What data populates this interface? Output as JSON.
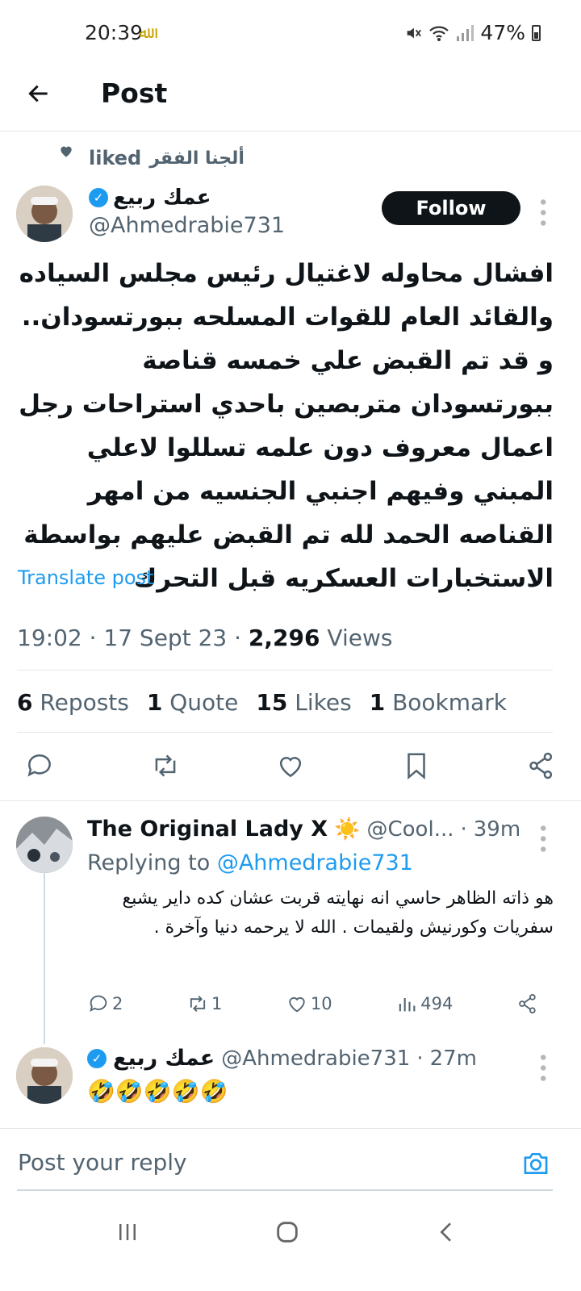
{
  "status_bar": {
    "time": "20:39",
    "battery": "47%"
  },
  "header": {
    "title": "Post"
  },
  "social_context": {
    "name": "ألجنا الفقر",
    "action": "liked"
  },
  "author": {
    "name": "عمك ربيع",
    "handle": "@Ahmedrabie731",
    "follow_label": "Follow"
  },
  "tweet": {
    "text": "افشال محاوله  لاغتيال رئيس مجلس السياده والقائد العام للقوات المسلحه ببورتسودان.. و قد تم القبض علي خمسه قناصة ببورتسودان متربصين باحدي استراحات رجل اعمال معروف دون علمه تسللوا لاعلي المبني  وفيهم اجنبي الجنسيه من امهر القناصه الحمد لله تم القبض عليهم بواسطة الاستخبارات العسكريه قبل التحرك",
    "translate_label": "Translate post",
    "time": "19:02",
    "date": "17 Sept 23",
    "views_count": "2,296",
    "views_label": "Views"
  },
  "stats": {
    "reposts_count": "6",
    "reposts_label": "Reposts",
    "quote_count": "1",
    "quote_label": "Quote",
    "likes_count": "15",
    "likes_label": "Likes",
    "bookmark_count": "1",
    "bookmark_label": "Bookmark"
  },
  "replies": [
    {
      "name": "The Original Lady X",
      "emoji": "☀️",
      "handle": "@Cool...",
      "time": "39m",
      "replying_prefix": "Replying to",
      "replying_to": "@Ahmedrabie731",
      "text": "هو ذاته الظاهر حاسي انه نهايته قربت عشان كده داير يشبع سفريات وكورنيش ولقيمات . الله لا يرحمه دنيا وآخرة .",
      "replies": "2",
      "reposts": "1",
      "likes": "10",
      "views": "494"
    },
    {
      "name": "عمك ربيع",
      "handle": "@Ahmedrabie731",
      "time": "27m",
      "text": "🤣🤣🤣🤣🤣"
    }
  ],
  "composer": {
    "placeholder": "Post your reply"
  },
  "colors": {
    "accent": "#1d9bf0",
    "text": "#0f1419",
    "secondary": "#536471"
  }
}
